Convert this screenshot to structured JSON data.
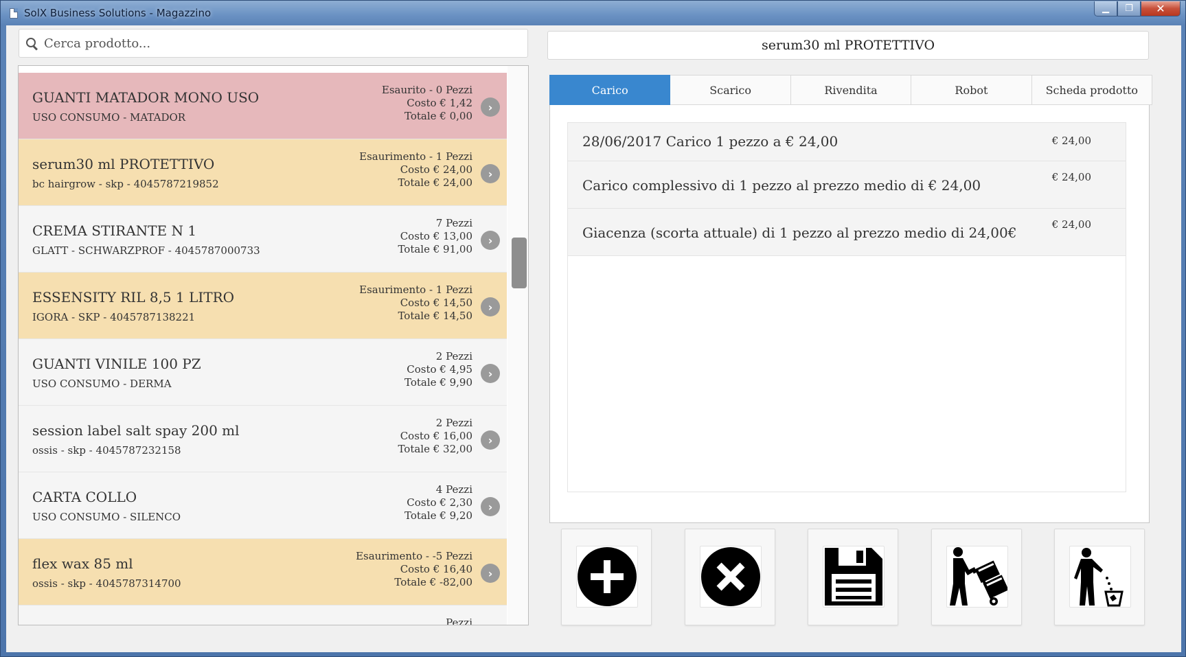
{
  "window": {
    "title": "SolX Business Solutions - Magazzino",
    "minimize": "▁",
    "maximize": "❐",
    "close": "✕"
  },
  "search": {
    "placeholder": "Cerca prodotto..."
  },
  "products": [
    {
      "name": "GUANTI MATADOR MONO USO",
      "sub": "USO CONSUMO - MATADOR",
      "status": "Esaurito - 0 Pezzi",
      "cost": "Costo € 1,42",
      "total": "Totale € 0,00",
      "state": "red"
    },
    {
      "name": "serum30 ml PROTETTIVO",
      "sub": "bc hairgrow - skp - 4045787219852",
      "status": "Esaurimento - 1 Pezzi",
      "cost": "Costo € 24,00",
      "total": "Totale € 24,00",
      "state": "amber"
    },
    {
      "name": "CREMA STIRANTE N 1",
      "sub": "GLATT - SCHWARZPROF - 4045787000733",
      "status": "7 Pezzi",
      "cost": "Costo € 13,00",
      "total": "Totale € 91,00",
      "state": "normal"
    },
    {
      "name": "ESSENSITY RIL 8,5 1 LITRO",
      "sub": "IGORA - SKP - 4045787138221",
      "status": "Esaurimento - 1 Pezzi",
      "cost": "Costo € 14,50",
      "total": "Totale € 14,50",
      "state": "amber"
    },
    {
      "name": "GUANTI VINILE 100 PZ",
      "sub": "USO CONSUMO - DERMA",
      "status": "2 Pezzi",
      "cost": "Costo € 4,95",
      "total": "Totale € 9,90",
      "state": "normal"
    },
    {
      "name": "session label salt spay 200 ml",
      "sub": "ossis - skp - 4045787232158",
      "status": "2 Pezzi",
      "cost": "Costo € 16,00",
      "total": "Totale € 32,00",
      "state": "normal"
    },
    {
      "name": "CARTA COLLO",
      "sub": "USO CONSUMO - SILENCO",
      "status": "4 Pezzi",
      "cost": "Costo € 2,30",
      "total": "Totale € 9,20",
      "state": "normal"
    },
    {
      "name": "flex wax 85 ml",
      "sub": "ossis - skp - 4045787314700",
      "status": "Esaurimento - -5 Pezzi",
      "cost": "Costo € 16,40",
      "total": "Totale € -82,00",
      "state": "amber"
    },
    {
      "name": "",
      "sub": "",
      "status": "Pezzi",
      "cost": "",
      "total": "",
      "state": "normal"
    }
  ],
  "selected_product": {
    "title": "serum30 ml PROTETTIVO"
  },
  "tabs": [
    {
      "label": "Carico",
      "active": true
    },
    {
      "label": "Scarico",
      "active": false
    },
    {
      "label": "Rivendita",
      "active": false
    },
    {
      "label": "Robot",
      "active": false
    },
    {
      "label": "Scheda prodotto",
      "active": false
    }
  ],
  "details": [
    {
      "text": "28/06/2017    Carico 1 pezzo a € 24,00",
      "amount": "€ 24,00"
    },
    {
      "text": "Carico complessivo di 1 pezzo al prezzo medio di € 24,00",
      "amount": "€ 24,00"
    },
    {
      "text": "Giacenza (scorta attuale) di 1 pezzo al prezzo medio di 24,00€",
      "amount": "€ 24,00"
    }
  ],
  "actions": [
    {
      "name": "add-button",
      "icon": "plus-circle-icon"
    },
    {
      "name": "cancel-button",
      "icon": "x-circle-icon"
    },
    {
      "name": "save-button",
      "icon": "floppy-disk-icon"
    },
    {
      "name": "delivery-button",
      "icon": "hand-truck-icon"
    },
    {
      "name": "discard-button",
      "icon": "trash-person-icon"
    }
  ],
  "colors": {
    "accent": "#3987cf",
    "row_red": "#e6b8bb",
    "row_amber": "#f6dfb0",
    "row_normal": "#f5f5f5"
  }
}
